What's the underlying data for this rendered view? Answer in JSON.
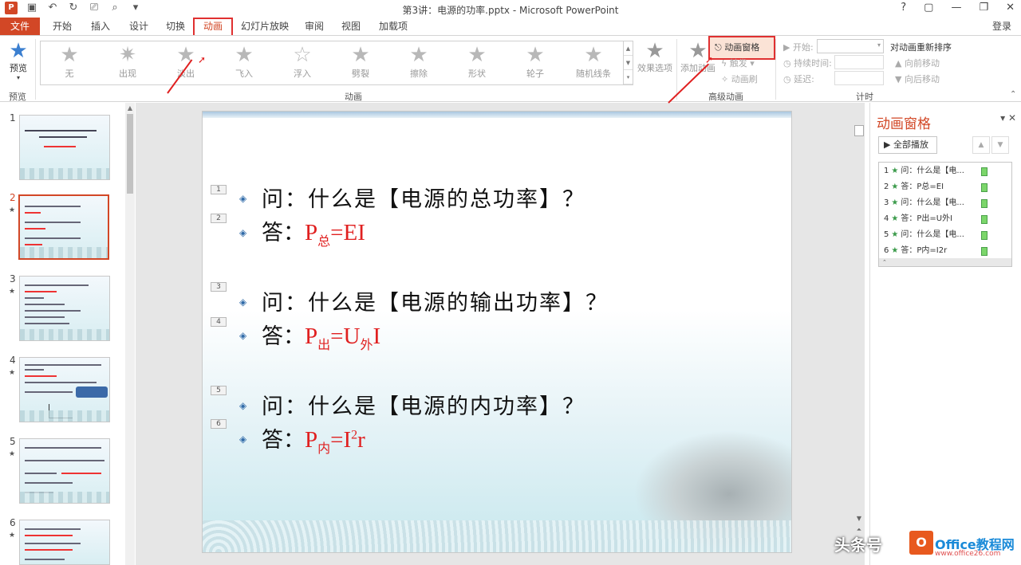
{
  "window": {
    "title": "第3讲：电源的功率.pptx - Microsoft PowerPoint",
    "controls": [
      "?",
      "▢",
      "—",
      "❐",
      "✕"
    ]
  },
  "tabs": [
    {
      "label": "文件"
    },
    {
      "label": "开始"
    },
    {
      "label": "插入"
    },
    {
      "label": "设计"
    },
    {
      "label": "切换"
    },
    {
      "label": "动画"
    },
    {
      "label": "幻灯片放映"
    },
    {
      "label": "审阅"
    },
    {
      "label": "视图"
    },
    {
      "label": "加载项"
    }
  ],
  "login": "登录",
  "ribbon": {
    "preview": {
      "label": "预览",
      "group": "预览"
    },
    "gallery": [
      "无",
      "出现",
      "淡出",
      "飞入",
      "浮入",
      "劈裂",
      "擦除",
      "形状",
      "轮子",
      "随机线条"
    ],
    "effect_options": "效果选项",
    "animation_group": "动画",
    "add_animation": "添加动画",
    "animation_pane": "动画窗格",
    "trigger": "触发",
    "painter": "动画刷",
    "advanced_group": "高级动画",
    "start": "开始:",
    "duration": "持续时间:",
    "delay": "延迟:",
    "timing_group": "计时",
    "reorder": "对动画重新排序",
    "move_earlier": "向前移动",
    "move_later": "向后移动"
  },
  "slides": [
    {
      "num": "1"
    },
    {
      "num": "2"
    },
    {
      "num": "3"
    },
    {
      "num": "4"
    },
    {
      "num": "5"
    },
    {
      "num": "6"
    }
  ],
  "slide": {
    "tags": [
      "1",
      "2",
      "3",
      "4",
      "5",
      "6"
    ],
    "q1": "问：什么是【电源的总功率】？",
    "a1_prefix": "答：",
    "a1_formula": {
      "p": "P",
      "sub": "总",
      "rest": "=EI"
    },
    "q2": "问：什么是【电源的输出功率】？",
    "a2_prefix": "答：",
    "a2_formula": {
      "p": "P",
      "sub": "出",
      "mid": "=U",
      "sub2": "外",
      "rest": "I"
    },
    "q3": "问：什么是【电源的内功率】？",
    "a3_prefix": "答：",
    "a3_formula": {
      "p": "P",
      "sub": "内",
      "mid": "=I",
      "sup": "2",
      "rest": "r"
    }
  },
  "pane": {
    "title": "动画窗格",
    "play_all": "全部播放",
    "items": [
      {
        "n": "1",
        "text": "问：什么是【电..."
      },
      {
        "n": "2",
        "text": "答：P总=EI"
      },
      {
        "n": "3",
        "text": "问：什么是【电..."
      },
      {
        "n": "4",
        "text": "答：P出=U外I"
      },
      {
        "n": "5",
        "text": "问：什么是【电..."
      },
      {
        "n": "6",
        "text": "答：P内=I2r"
      }
    ]
  },
  "watermark": {
    "text": "头条号",
    "brand": "Office教程网",
    "url": "www.office26.com"
  },
  "colors": {
    "accent": "#d24726",
    "highlight_box": "#e03030",
    "formula": "#e02020"
  }
}
